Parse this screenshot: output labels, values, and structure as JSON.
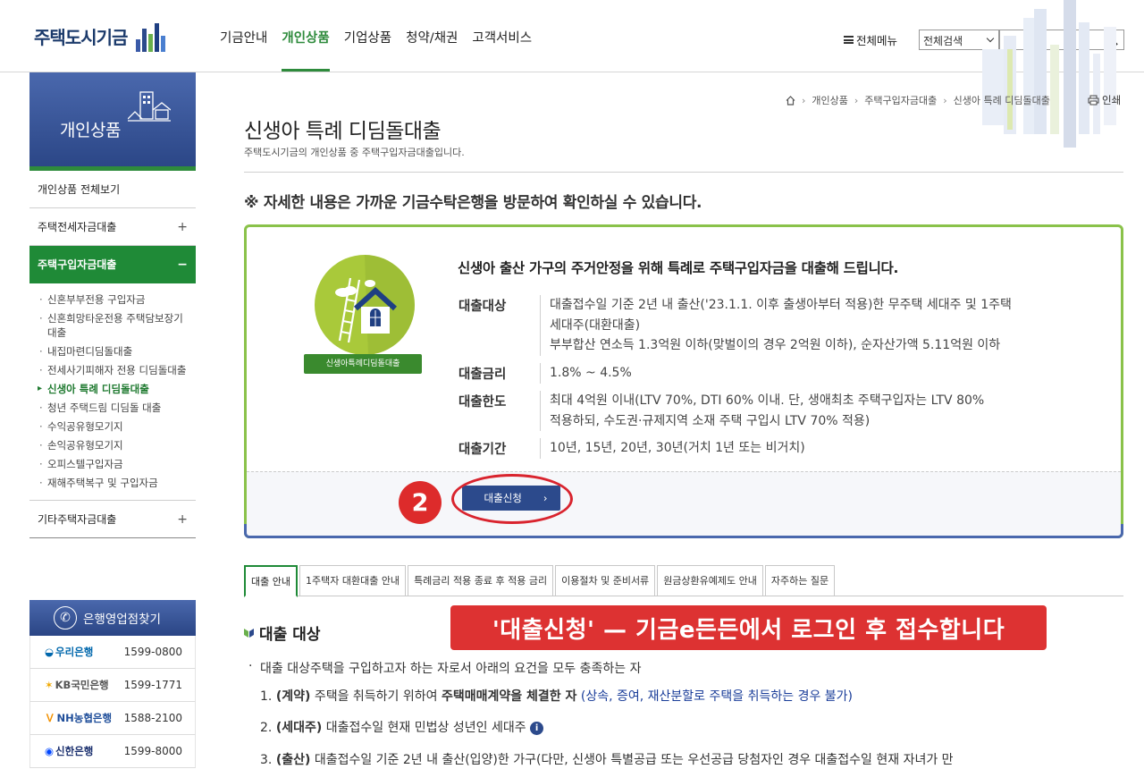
{
  "header": {
    "logo_text": "주택도시기금",
    "nav": [
      "기금안내",
      "개인상품",
      "기업상품",
      "청약/채권",
      "고객서비스"
    ],
    "all_menu": "전체메뉴",
    "search_scope": "전체검색",
    "search_placeholder": ""
  },
  "sidebar": {
    "title": "개인상품",
    "items": [
      {
        "label": "개인상품 전체보기",
        "toggle": ""
      },
      {
        "label": "주택전세자금대출",
        "toggle": "+"
      },
      {
        "label": "주택구입자금대출",
        "toggle": "−"
      },
      {
        "label": "기타주택자금대출",
        "toggle": "+"
      }
    ],
    "sub_items": [
      "신혼부부전용 구입자금",
      "신혼희망타운전용 주택담보장기대출",
      "내집마련디딤돌대출",
      "전세사기피해자 전용 디딤돌대출",
      "신생아 특례 디딤돌대출",
      "청년 주택드림 디딤돌 대출",
      "수익공유형모기지",
      "손익공유형모기지",
      "오피스텔구입자금",
      "재해주택복구 및 구입자금"
    ],
    "bank_title": "은행영업점찾기",
    "banks": [
      {
        "name": "우리은행",
        "phone": "1599-0800",
        "color": "#0067ac"
      },
      {
        "name": "KB국민은행",
        "phone": "1599-1771",
        "color": "#f0a800"
      },
      {
        "name": "NH농협은행",
        "phone": "1588-2100",
        "color": "#f29100"
      },
      {
        "name": "신한은행",
        "phone": "1599-8000",
        "color": "#0046ff"
      }
    ]
  },
  "breadcrumb": [
    "개인상품",
    "주택구입자금대출",
    "신생아 특례 디딤돌대출"
  ],
  "print_label": "인쇄",
  "page": {
    "title": "신생아 특례 디딤돌대출",
    "desc": "주택도시기금의 개인상품 중 주택구입자금대출입니다.",
    "notice": "※ 자세한 내용은 가까운 기금수탁은행을 방문하여 확인하실 수 있습니다."
  },
  "product": {
    "badge_label": "신생아특례디딤돌대출",
    "heading": "신생아 출산 가구의 주거안정을 위해 특례로 주택구입자금을 대출해 드립니다.",
    "rows": [
      {
        "label": "대출대상",
        "lines": [
          "대출접수일 기준 2년 내 출산('23.1.1. 이후 출생아부터 적용)한 무주택 세대주 및 1주택",
          "세대주(대환대출)",
          "부부합산 연소득 1.3억원 이하(맞벌이의 경우 2억원 이하), 순자산가액 5.11억원 이하"
        ]
      },
      {
        "label": "대출금리",
        "lines": [
          "1.8% ~ 4.5%"
        ]
      },
      {
        "label": "대출한도",
        "lines": [
          "최대 4억원 이내(LTV 70%, DTI 60% 이내. 단, 생애최초 주택구입자는 LTV 80%",
          "적용하되, 수도권·규제지역 소재 주택 구입시 LTV 70% 적용)"
        ]
      },
      {
        "label": "대출기간",
        "lines": [
          "10년, 15년, 20년, 30년(거치 1년 또는 비거치)"
        ]
      }
    ],
    "apply_label": "대출신청",
    "step_number": "2"
  },
  "tabs": [
    "대출 안내",
    "1주택자 대환대출 안내",
    "특례금리 적용 종료 후 적용 금리",
    "이용절차 및 준비서류",
    "원금상환유예제도 안내",
    "자주하는 질문"
  ],
  "section": {
    "title": "대출 대상",
    "lead": "대출 대상주택을 구입하고자 하는 자로서 아래의 요건을 모두 충족하는 자",
    "item1": {
      "num": "1.",
      "head": "(계약)",
      "mid": "주택을 취득하기 위하여",
      "bold": "주택매매계약을 체결한 자",
      "note": "(상속, 증여, 재산분할로 주택을 취득하는 경우 불가)"
    },
    "item2": {
      "num": "2.",
      "head": "(세대주)",
      "mid": "대출접수일 현재 민법상 성년인 세대주"
    },
    "item3": {
      "num": "3.",
      "head": "(출산)",
      "mid": "대출접수일 기준 2년 내 출산(입양)한 가구(다만, 신생아 특별공급 또는 우선공급 당첨자인 경우 대출접수일 현재 자녀가 만"
    }
  },
  "callout": "'대출신청' — 기금e든든에서 로그인 후 접수합니다",
  "colors": {
    "green": "#1f8a37",
    "navy": "#2c4a8c",
    "red": "#dd2b2b"
  }
}
